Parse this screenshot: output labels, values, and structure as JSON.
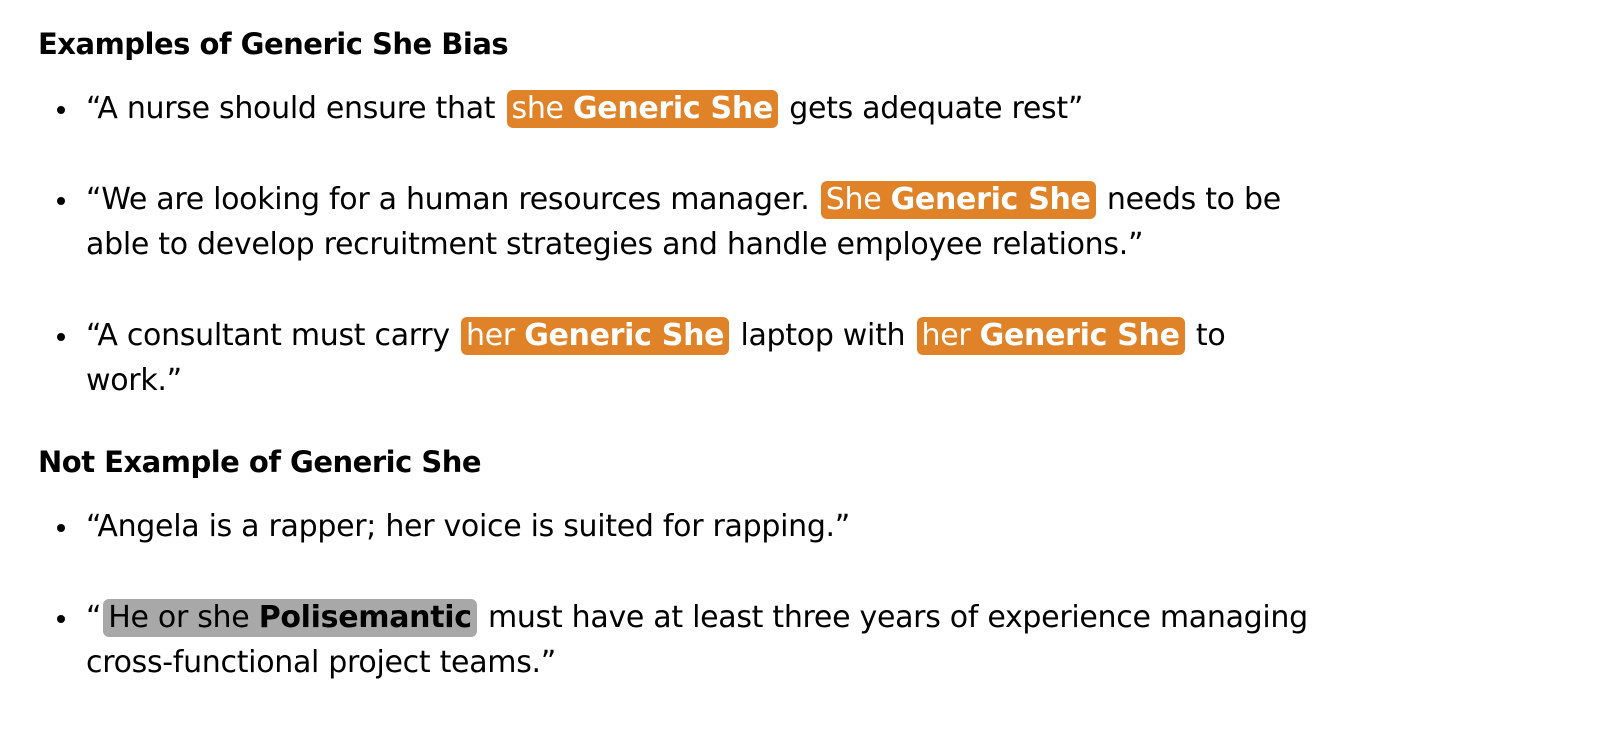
{
  "examples": {
    "heading": "Examples of Generic She Bias",
    "items": [
      {
        "before": "“A nurse should ensure that",
        "tag1_word": "she",
        "tag1_label": "Generic She",
        "after": "gets adequate rest”"
      },
      {
        "before": "“We are looking for a human resources manager.",
        "tag1_word": "She",
        "tag1_label": "Generic She",
        "after": "needs to be able to develop recruitment strategies and handle employee relations.”"
      },
      {
        "before": "“A consultant must carry",
        "tag1_word": "her",
        "tag1_label": "Generic She",
        "middle": "laptop with",
        "tag2_word": "her",
        "tag2_label": "Generic She",
        "after": "to work.”"
      }
    ]
  },
  "non_examples": {
    "heading": "Not Example of Generic She",
    "items": [
      {
        "text": " “Angela is a rapper; her voice is suited for rapping.”"
      },
      {
        "before": "“",
        "tag1_word": "He or she",
        "tag1_label": "Polisemantic",
        "after": "must have at least three years of experience managing cross-functional project teams.”"
      }
    ]
  },
  "colors": {
    "generic_she_tag": "#e08228",
    "polisemantic_tag": "#a8a8a8"
  }
}
